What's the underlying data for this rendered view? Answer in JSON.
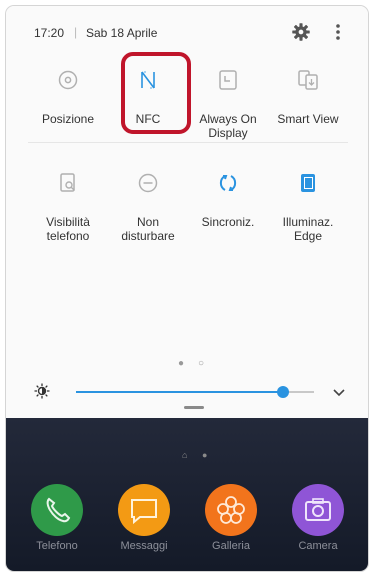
{
  "status_bar": {
    "time": "17:20",
    "separator": "|",
    "date": "Sab 18 Aprile",
    "icons": [
      "gear-icon",
      "more-vert-icon"
    ]
  },
  "quick_tiles": [
    {
      "label": "Posizione",
      "icon": "location-icon",
      "active": false
    },
    {
      "label": "NFC",
      "icon": "nfc-icon",
      "active": true,
      "highlighted": true
    },
    {
      "label": "Always On\nDisplay",
      "icon": "always-on-display-icon",
      "active": false
    },
    {
      "label": "Smart View",
      "icon": "smart-view-icon",
      "active": false
    },
    {
      "label": "Visibilità\ntelefono",
      "icon": "phone-visibility-icon",
      "active": false
    },
    {
      "label": "Non\ndisturbare",
      "icon": "do-not-disturb-icon",
      "active": false
    },
    {
      "label": "Sincroniz.",
      "icon": "sync-icon",
      "active": true
    },
    {
      "label": "Illuminaz.\nEdge",
      "icon": "edge-lighting-icon",
      "active": true
    }
  ],
  "pager": {
    "pages": 2,
    "current": 1
  },
  "brightness": {
    "level": 0.87,
    "icon": "brightness-icon",
    "expand_icon": "chevron-down-icon"
  },
  "home_apps": [
    {
      "label": "Telefono",
      "icon": "phone-icon",
      "color": "#2f9a49"
    },
    {
      "label": "Messaggi",
      "icon": "messages-icon",
      "color": "#f39a14"
    },
    {
      "label": "Galleria",
      "icon": "gallery-icon",
      "color": "#f2741c"
    },
    {
      "label": "Camera",
      "icon": "camera-icon",
      "color": "#8f55d6"
    }
  ],
  "colors": {
    "accent": "#2a93e0",
    "highlight_box": "#c0152b",
    "inactive_icon": "#b0b0b0"
  }
}
